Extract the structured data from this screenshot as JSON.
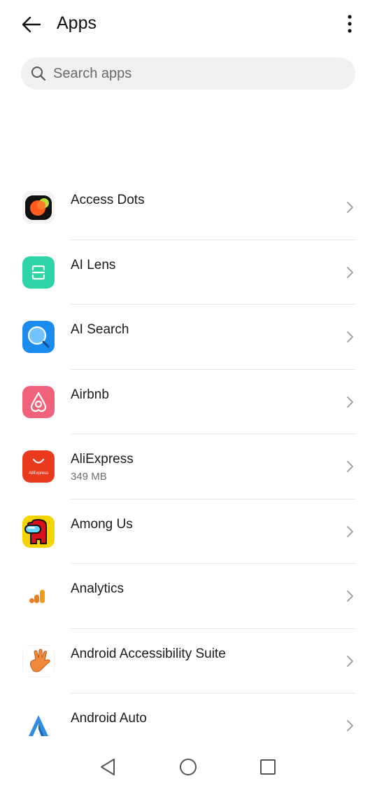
{
  "header": {
    "title": "Apps"
  },
  "search": {
    "placeholder": "Search apps"
  },
  "apps": [
    {
      "name": "Access Dots",
      "sub": "",
      "icon": "access-dots-icon"
    },
    {
      "name": "AI Lens",
      "sub": "",
      "icon": "ai-lens-icon"
    },
    {
      "name": "AI Search",
      "sub": "",
      "icon": "ai-search-icon"
    },
    {
      "name": "Airbnb",
      "sub": "",
      "icon": "airbnb-icon"
    },
    {
      "name": "AliExpress",
      "sub": "349 MB",
      "icon": "aliexpress-icon",
      "icon_text": "AliExpress"
    },
    {
      "name": "Among Us",
      "sub": "",
      "icon": "among-us-icon"
    },
    {
      "name": "Analytics",
      "sub": "",
      "icon": "analytics-icon"
    },
    {
      "name": "Android Accessibility Suite",
      "sub": "",
      "icon": "accessibility-hand-icon"
    },
    {
      "name": "Android Auto",
      "sub": "",
      "icon": "android-auto-icon"
    }
  ],
  "colors": {
    "ai_lens": "#2fd4a6",
    "ai_search": "#1a8cf0",
    "airbnb": "#f0627a",
    "aliexpress": "#ea3a1e",
    "among_us_bg": "#f5d400",
    "analytics_orange": "#f39c12",
    "android_auto_blue": "#2f8de4"
  },
  "navigation": {
    "back": "back-triangle-icon",
    "home": "home-circle-icon",
    "recents": "recents-square-icon"
  }
}
